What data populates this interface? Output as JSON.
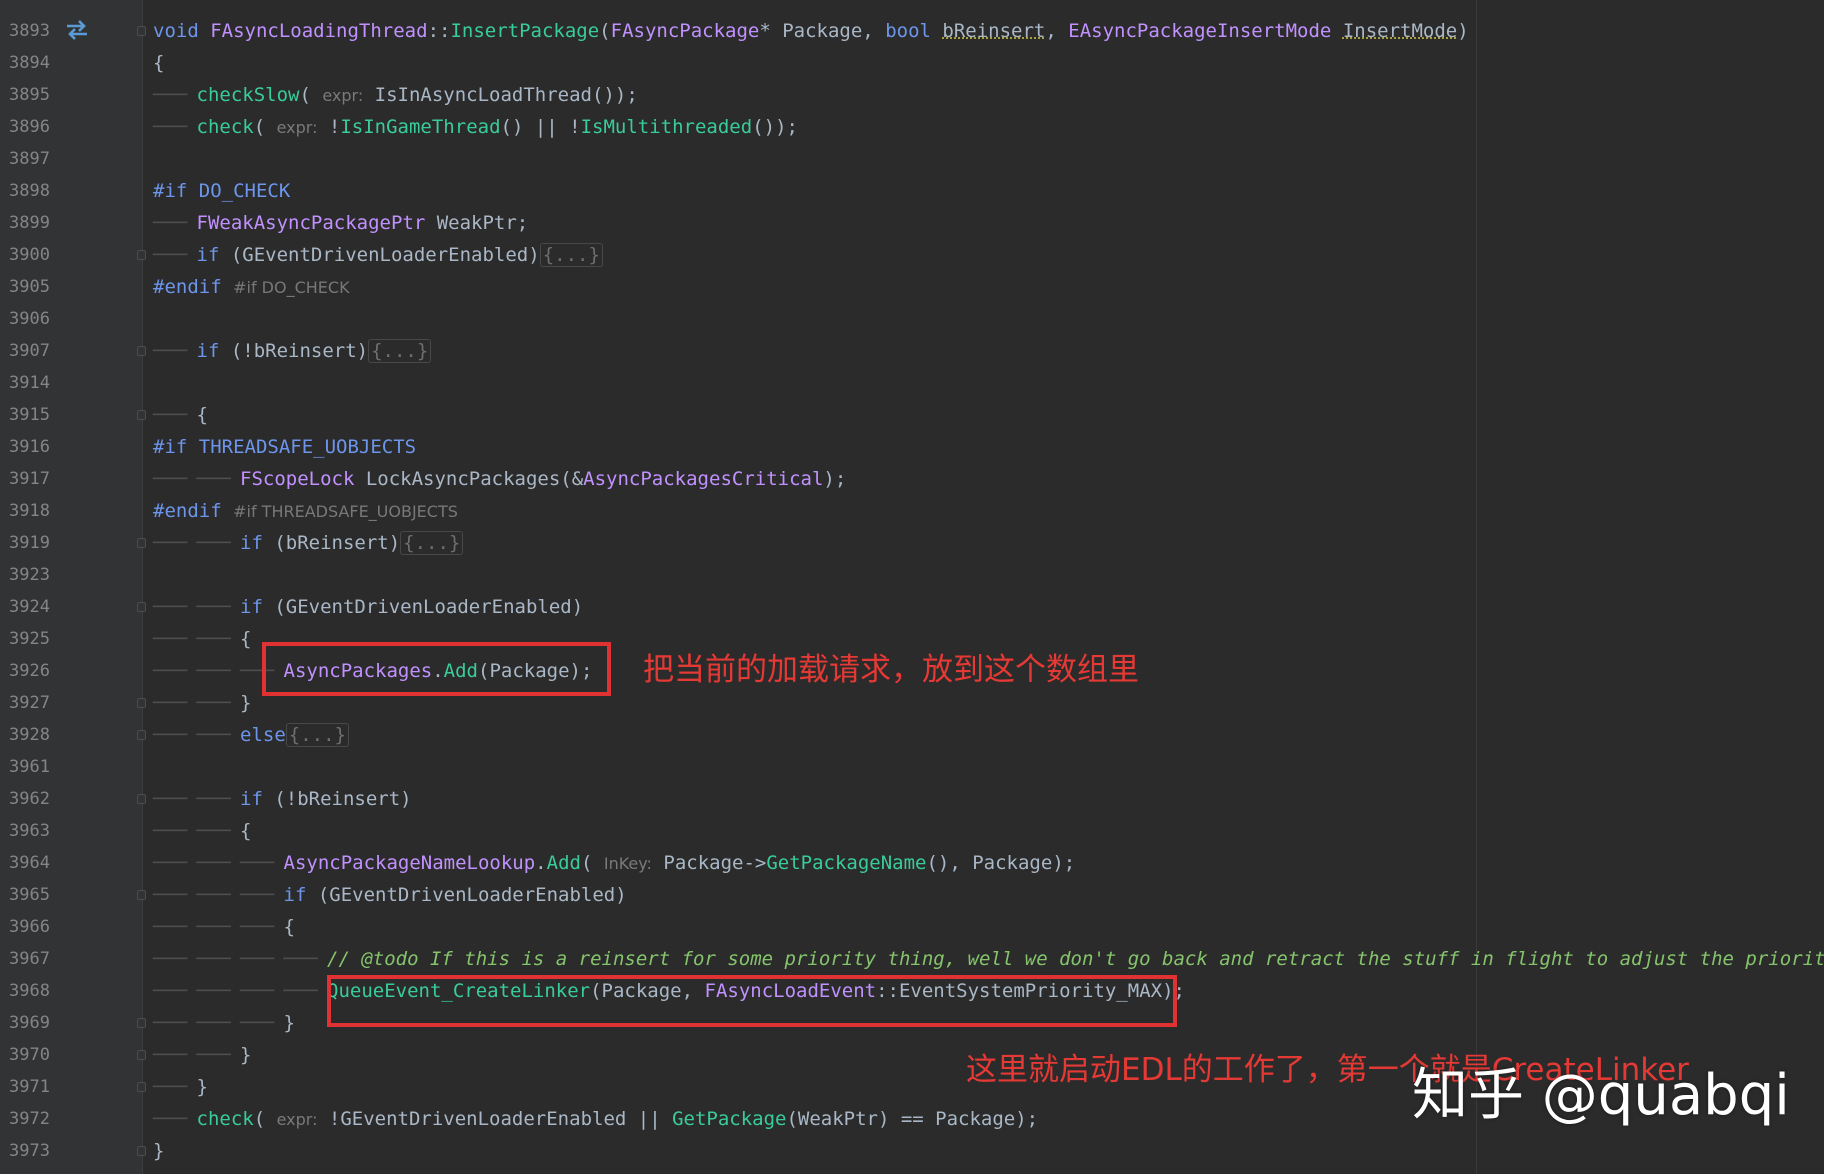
{
  "editor": {
    "lines": [
      {
        "num": "3893",
        "text": "void FAsyncLoadingThread::InsertPackage(FAsyncPackage* Package, bool bReinsert, EAsyncPackageInsertMode InsertMode)"
      },
      {
        "num": "3894",
        "text": "{"
      },
      {
        "num": "3895",
        "text": "checkSlow( expr: IsInAsyncLoadThread());"
      },
      {
        "num": "3896",
        "text": "check( expr: !IsInGameThread() || !IsMultithreaded());"
      },
      {
        "num": "3897",
        "text": ""
      },
      {
        "num": "3898",
        "text": "#if DO_CHECK"
      },
      {
        "num": "3899",
        "text": "FWeakAsyncPackagePtr WeakPtr;"
      },
      {
        "num": "3900",
        "text": "if (GEventDrivenLoaderEnabled){...}"
      },
      {
        "num": "3905",
        "text": "#endif #if DO_CHECK"
      },
      {
        "num": "3906",
        "text": ""
      },
      {
        "num": "3907",
        "text": "if (!bReinsert){...}"
      },
      {
        "num": "3914",
        "text": ""
      },
      {
        "num": "3915",
        "text": "{"
      },
      {
        "num": "3916",
        "text": "#if THREADSAFE_UOBJECTS"
      },
      {
        "num": "3917",
        "text": "FScopeLock LockAsyncPackages(&AsyncPackagesCritical);"
      },
      {
        "num": "3918",
        "text": "#endif #if THREADSAFE_UOBJECTS"
      },
      {
        "num": "3919",
        "text": "if (bReinsert){...}"
      },
      {
        "num": "3923",
        "text": ""
      },
      {
        "num": "3924",
        "text": "if (GEventDrivenLoaderEnabled)"
      },
      {
        "num": "3925",
        "text": "{"
      },
      {
        "num": "3926",
        "text": "AsyncPackages.Add(Package);"
      },
      {
        "num": "3927",
        "text": "}"
      },
      {
        "num": "3928",
        "text": "else{...}"
      },
      {
        "num": "3961",
        "text": ""
      },
      {
        "num": "3962",
        "text": "if (!bReinsert)"
      },
      {
        "num": "3963",
        "text": "{"
      },
      {
        "num": "3964",
        "text": "AsyncPackageNameLookup.Add( InKey: Package->GetPackageName(), Package);"
      },
      {
        "num": "3965",
        "text": "if (GEventDrivenLoaderEnabled)"
      },
      {
        "num": "3966",
        "text": "{"
      },
      {
        "num": "3967",
        "text": "// @todo If this is a reinsert for some priority thing, well we don't go back and retract the stuff in flight to adjust the priority of"
      },
      {
        "num": "3968",
        "text": "QueueEvent_CreateLinker(Package, FAsyncLoadEvent::EventSystemPriority_MAX);"
      },
      {
        "num": "3969",
        "text": "}"
      },
      {
        "num": "3970",
        "text": "}"
      },
      {
        "num": "3971",
        "text": "}"
      },
      {
        "num": "3972",
        "text": "check( expr: !GEventDrivenLoaderEnabled || GetPackage(WeakPtr) == Package);"
      },
      {
        "num": "3973",
        "text": "}"
      }
    ]
  },
  "annotations": {
    "note1": "把当前的加载请求，放到这个数组里",
    "note2": "这里就启动EDL的工作了，第一个就是CreateLinker"
  },
  "watermark": "知乎 @quabqi",
  "icons": {
    "gutter": "swap-arrows-icon"
  },
  "colors": {
    "background": "#2b2b2b",
    "highlight_box": "#e03232",
    "annotation_text": "#e53935"
  }
}
